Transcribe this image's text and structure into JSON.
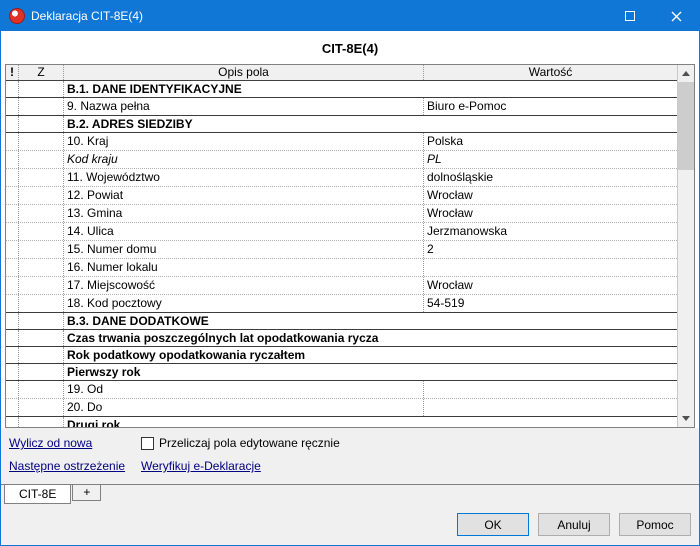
{
  "window": {
    "title": "Deklaracja CIT-8E(4)"
  },
  "icons": {
    "app_logo": "red-circle-logo",
    "maximize": "square-outline",
    "close": "x-mark",
    "scroll_up": "triangle-up",
    "scroll_down": "triangle-down"
  },
  "colors": {
    "titlebar": "#1177d7",
    "link": "#000080",
    "default_button_border": "#0078d7"
  },
  "form": {
    "title": "CIT-8E(4)"
  },
  "table": {
    "headers": {
      "warn": "!",
      "z": "Z",
      "opis": "Opis pola",
      "wartosc": "Wartość"
    },
    "rows": [
      {
        "type": "section",
        "label": "B.1. DANE IDENTYFIKACYJNE"
      },
      {
        "type": "field",
        "label": "9. Nazwa pełna",
        "value": "Biuro e-Pomoc"
      },
      {
        "type": "section",
        "label": "B.2. ADRES SIEDZIBY"
      },
      {
        "type": "field",
        "label": "10. Kraj",
        "value": "Polska"
      },
      {
        "type": "field-italic",
        "label": "Kod kraju",
        "value": "PL"
      },
      {
        "type": "field",
        "label": "11. Województwo",
        "value": "dolnośląskie"
      },
      {
        "type": "field",
        "label": "12. Powiat",
        "value": "Wrocław"
      },
      {
        "type": "field",
        "label": "13. Gmina",
        "value": "Wrocław"
      },
      {
        "type": "field",
        "label": "14. Ulica",
        "value": "Jerzmanowska"
      },
      {
        "type": "field",
        "label": "15. Numer domu",
        "value": "2"
      },
      {
        "type": "field",
        "label": "16. Numer lokalu",
        "value": ""
      },
      {
        "type": "field",
        "label": "17. Miejscowość",
        "value": "Wrocław"
      },
      {
        "type": "field",
        "label": "18. Kod pocztowy",
        "value": "54-519"
      },
      {
        "type": "section",
        "label": "B.3. DANE DODATKOWE"
      },
      {
        "type": "subsection",
        "label": "Czas trwania poszczególnych lat opodatkowania rycza"
      },
      {
        "type": "subsection",
        "label": "Rok podatkowy opodatkowania ryczałtem"
      },
      {
        "type": "subsection",
        "label": "Pierwszy rok"
      },
      {
        "type": "field",
        "label": "19. Od",
        "value": ""
      },
      {
        "type": "field",
        "label": "20. Do",
        "value": ""
      },
      {
        "type": "subsection",
        "label": "Drugi rok"
      }
    ]
  },
  "footer": {
    "links": {
      "wylicz": "Wylicz od nowa",
      "nastepne": "Następne ostrzeżenie",
      "weryfikuj": "Weryfikuj e-Deklaracje"
    },
    "checkbox_label": "Przeliczaj pola edytowane ręcznie"
  },
  "tabs": [
    {
      "label": "CIT-8E"
    },
    {
      "label": "+"
    }
  ],
  "buttons": {
    "ok": "OK",
    "cancel": "Anuluj",
    "help": "Pomoc"
  }
}
